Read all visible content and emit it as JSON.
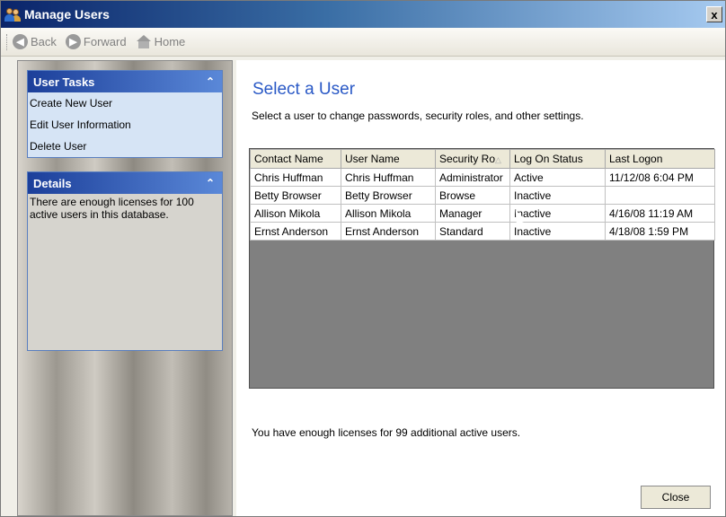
{
  "window": {
    "title": "Manage Users",
    "close_label": "x"
  },
  "toolbar": {
    "back_label": "Back",
    "forward_label": "Forward",
    "home_label": "Home"
  },
  "sidebar": {
    "user_tasks": {
      "header": "User Tasks",
      "items": [
        "Create New User",
        "Edit User Information",
        "Delete User"
      ]
    },
    "details": {
      "header": "Details",
      "text": "There are enough licenses for 100 active users in this database."
    }
  },
  "main": {
    "heading": "Select a User",
    "subtitle": "Select a user to change passwords, security roles, and other settings.",
    "table": {
      "columns": [
        "Contact Name",
        "User Name",
        "Security Ro",
        "Log On Status",
        "Last Logon"
      ],
      "rows": [
        [
          "Chris Huffman",
          "Chris Huffman",
          "Administrator",
          "Active",
          "11/12/08 6:04 PM"
        ],
        [
          "Betty Browser",
          "Betty Browser",
          "Browse",
          "Inactive",
          ""
        ],
        [
          "Allison Mikola",
          "Allison Mikola",
          "Manager",
          "Inactive",
          "4/16/08 11:19 AM"
        ],
        [
          "Ernst Anderson",
          "Ernst Anderson",
          "Standard",
          "Inactive",
          "4/18/08 1:59 PM"
        ]
      ]
    },
    "footer_text": "You have enough licenses for 99 additional active users.",
    "close_button": "Close"
  },
  "icons": {
    "app": "users-icon",
    "back": "back-arrow-icon",
    "forward": "forward-arrow-icon",
    "home": "home-icon",
    "collapse": "chevron-up-icon"
  },
  "colors": {
    "heading": "#2a59c6",
    "panel_header": "#1c3f9a"
  }
}
